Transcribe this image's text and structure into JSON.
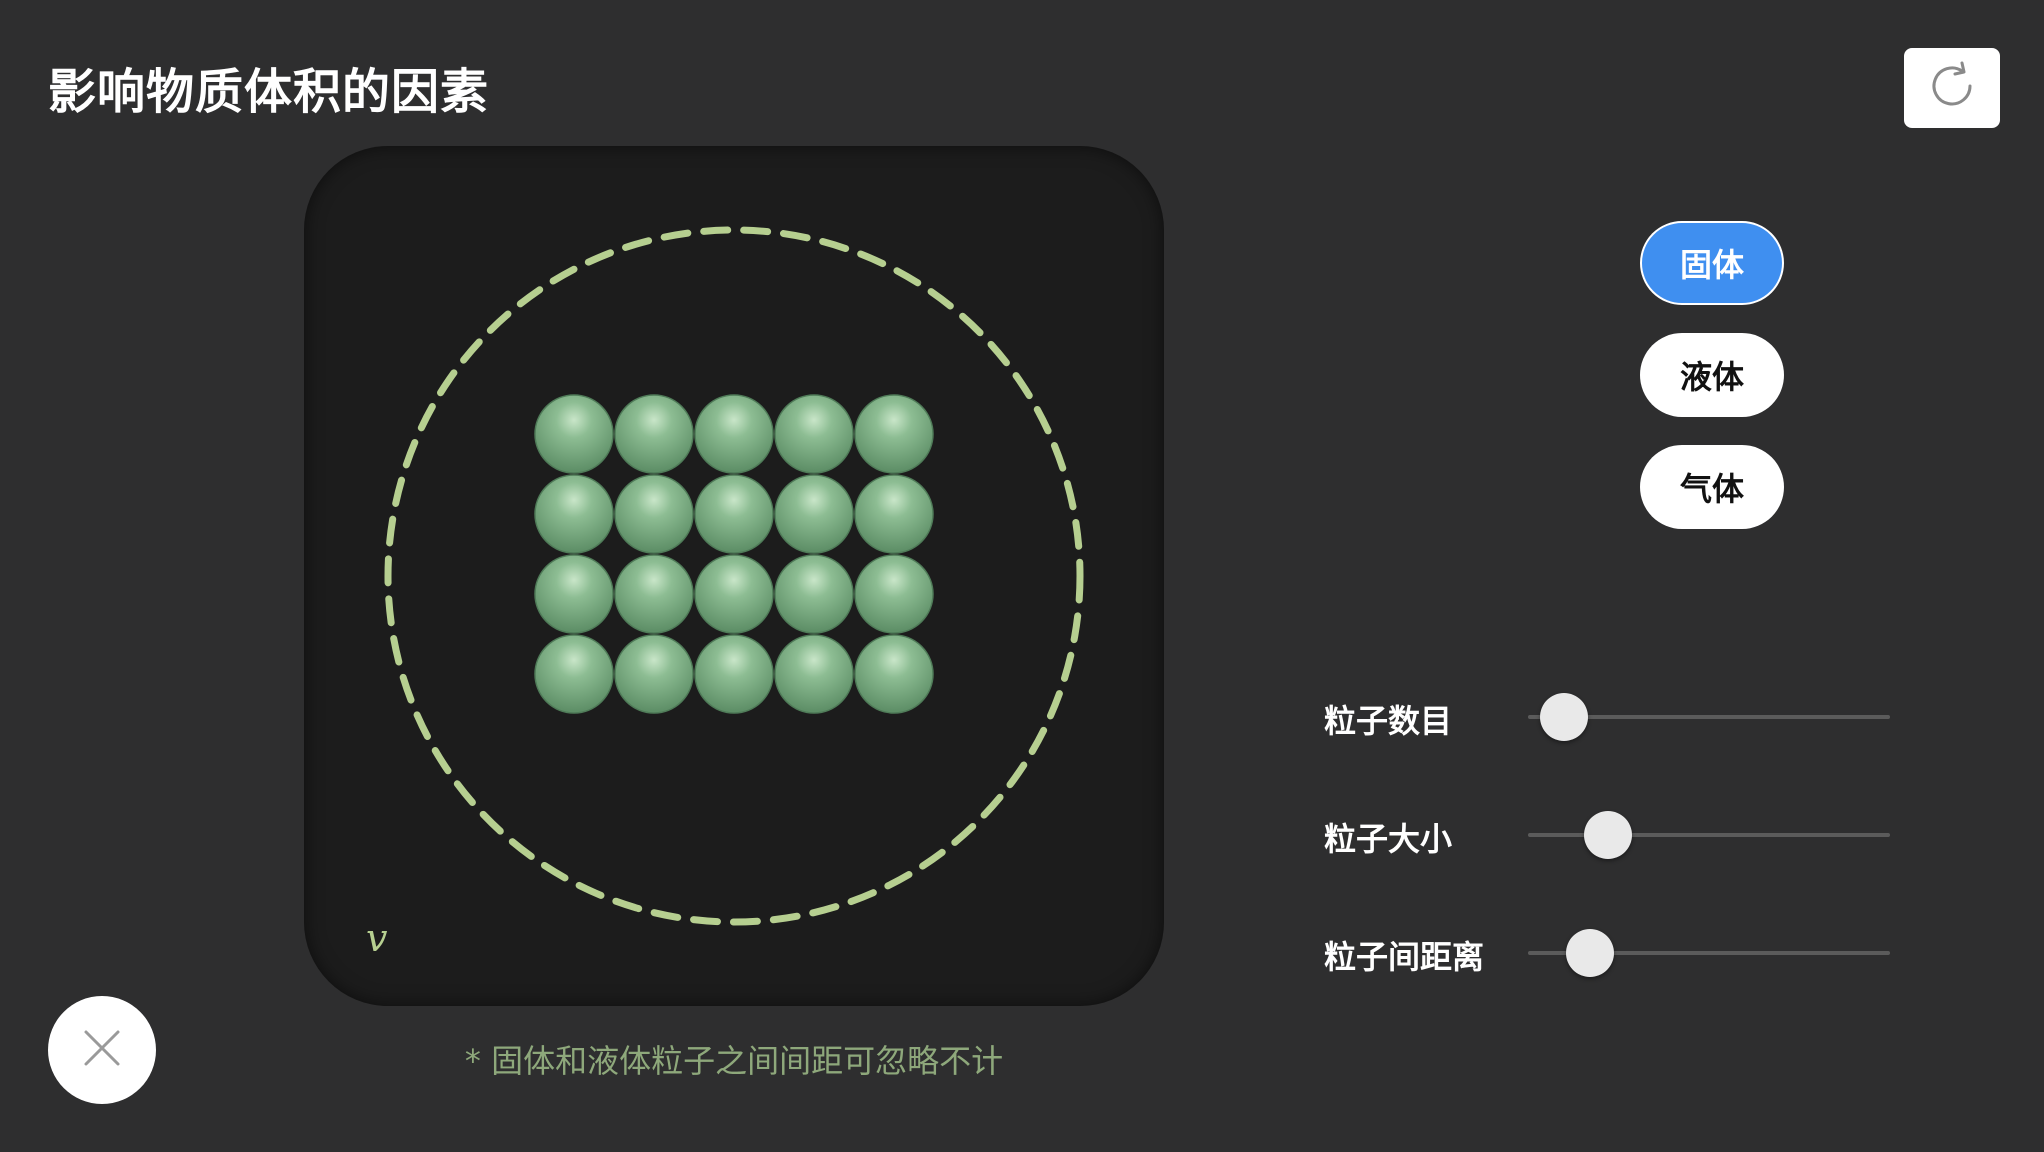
{
  "header": {
    "title": "影响物质体积的因素",
    "reset_icon": "refresh-icon"
  },
  "stage": {
    "volume_symbol": "v",
    "boundary_color": "#b6cf90",
    "particle_color": "#7fb08a",
    "particles": {
      "rows": 4,
      "cols": 5
    }
  },
  "footnote": "* 固体和液体粒子之间间距可忽略不计",
  "states": {
    "selected": "固体",
    "items": [
      {
        "label": "固体",
        "active": true
      },
      {
        "label": "液体",
        "active": false
      },
      {
        "label": "气体",
        "active": false
      }
    ]
  },
  "sliders": [
    {
      "label": "粒子数目",
      "value": 0.1
    },
    {
      "label": "粒子大小",
      "value": 0.22
    },
    {
      "label": "粒子间距离",
      "value": 0.17
    }
  ],
  "colors": {
    "background": "#2e2e2f",
    "stage": "#1c1c1c",
    "accent": "#3f8ff0",
    "footnote": "#8ea87b"
  },
  "close_icon": "close-icon"
}
